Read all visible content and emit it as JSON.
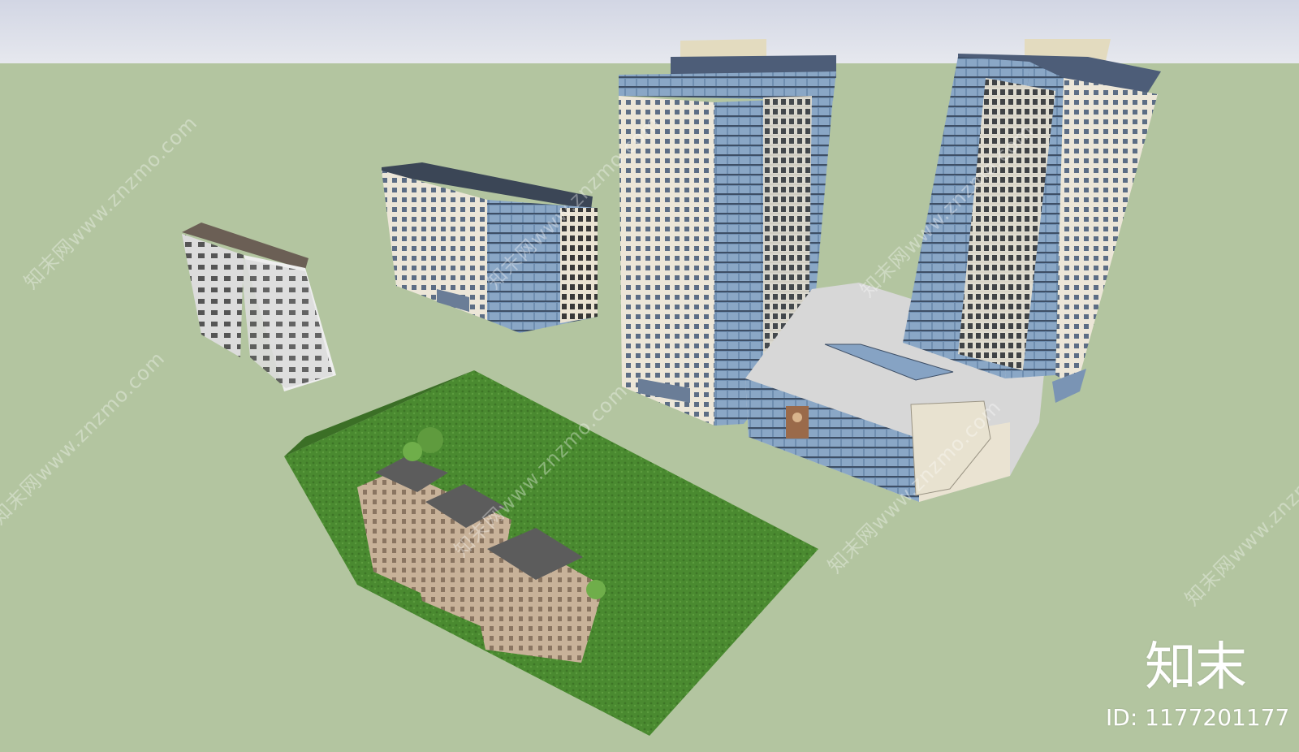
{
  "colors": {
    "sky_top": "#d2d6e4",
    "sky_bottom": "#e6e8ee",
    "ground": "#b3c5a0",
    "lawn": "#4a8a30",
    "glass": "#6f8eb0",
    "stone": "#ece6d8",
    "villa": "#c8b299",
    "roof_dark": "#5c5c5c"
  },
  "scene_objects": {
    "tower_left": "glass-tower-left",
    "tower_right": "glass-tower-right",
    "podium": "shopping-podium",
    "office_block": "office-block",
    "residential_block": "residential-block",
    "villa_row": "townhouse-row",
    "lawn": "lawn-plot"
  },
  "watermark": {
    "text": "知末网www.znzmo.com"
  },
  "logo": {
    "text": "知末"
  },
  "id_label": {
    "text": "ID: 1177201177"
  }
}
